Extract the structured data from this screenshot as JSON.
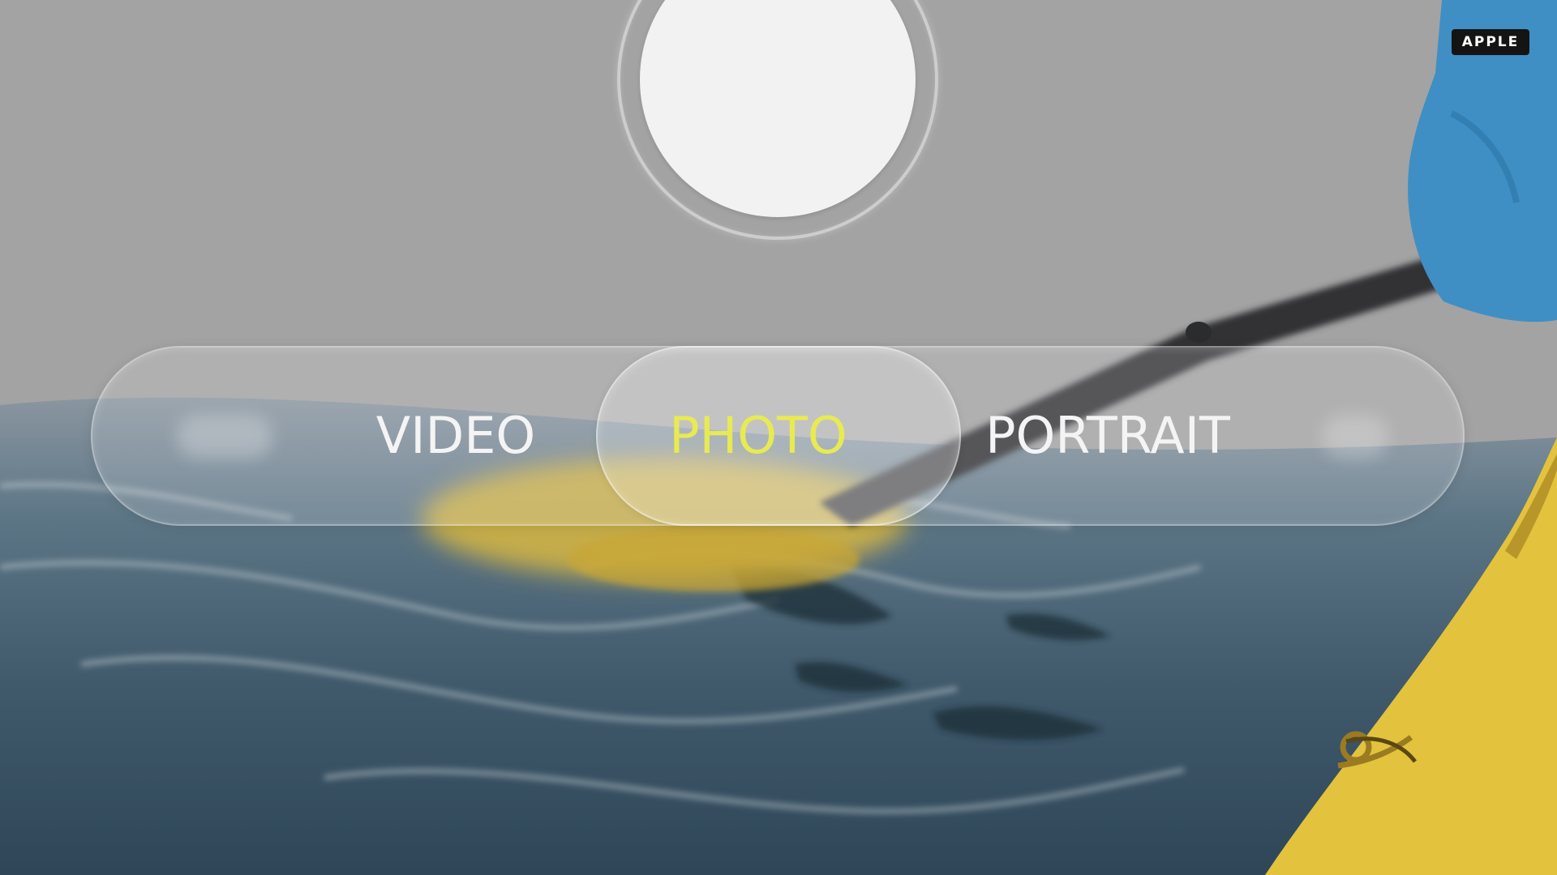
{
  "watermark": "APPLE",
  "camera": {
    "modes": [
      {
        "label": "VIDEO",
        "selected": false
      },
      {
        "label": "PHOTO",
        "selected": true
      },
      {
        "label": "PORTRAIT",
        "selected": false
      }
    ],
    "selected_color": "#e8ea52",
    "label_color": "#f4f4f4"
  },
  "icons": {
    "shutter": "shutter-button"
  },
  "scene_colors": {
    "sky": "#a3a3a3",
    "water": "#4e6b7f",
    "kayak": "#e3c23d",
    "sleeve": "#3f8fc4"
  }
}
